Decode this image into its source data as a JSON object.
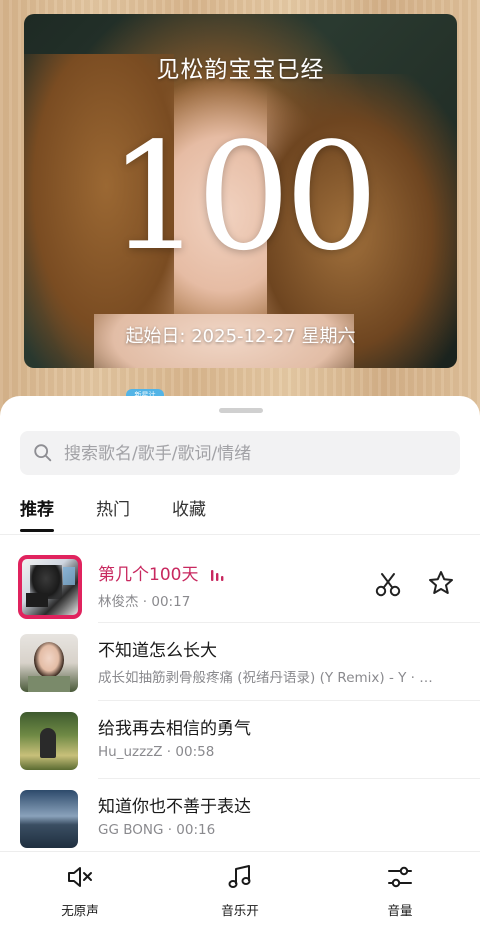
{
  "photo": {
    "title": "见松韵宝宝已经",
    "number": "100",
    "date_line": "起始日: 2025-12-27 星期六",
    "badge": "新星计"
  },
  "search": {
    "placeholder": "搜索歌名/歌手/歌词/情绪"
  },
  "tabs": [
    {
      "label": "推荐",
      "active": true
    },
    {
      "label": "热门",
      "active": false
    },
    {
      "label": "收藏",
      "active": false
    }
  ],
  "songs": [
    {
      "title": "第几个100天",
      "artist": "林俊杰",
      "duration": "00:17",
      "meta": "林俊杰 · 00:17",
      "active": true
    },
    {
      "title": "不知道怎么长大",
      "meta": "成长如抽筋剥骨般疼痛 (祝绪丹语录) (Y Remix) - Y · …",
      "active": false
    },
    {
      "title": "给我再去相信的勇气",
      "meta": "Hu_uzzzZ · 00:58",
      "active": false
    },
    {
      "title": "知道你也不善于表达",
      "meta": "GG BONG · 00:16",
      "active": false
    }
  ],
  "bottom_bar": {
    "mute_label": "无原声",
    "music_label": "音乐开",
    "volume_label": "音量"
  },
  "colors": {
    "accent": "#c8285f",
    "active_border": "#e0235e"
  },
  "icons": [
    "search-icon",
    "equalizer-icon",
    "scissors-icon",
    "star-icon",
    "speaker-mute-icon",
    "music-note-icon",
    "sliders-icon"
  ]
}
